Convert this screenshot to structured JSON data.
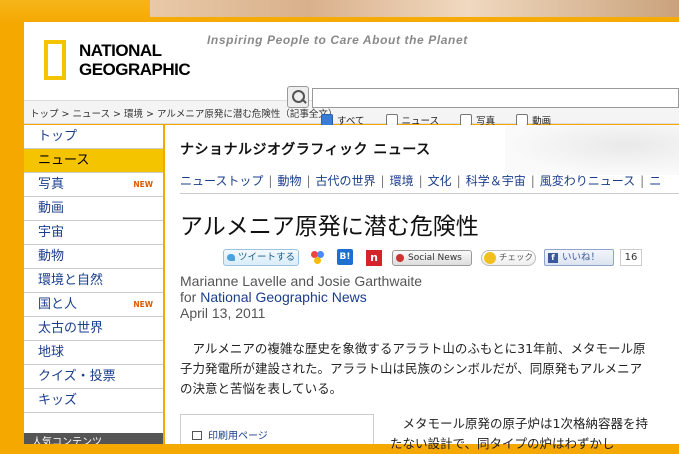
{
  "site": {
    "logo_line1": "NATIONAL",
    "logo_line2": "GEOGRAPHIC",
    "tagline": "Inspiring People to Care About the Planet",
    "brand_color": "#f5c400"
  },
  "breadcrumb": [
    "トップ",
    "ニュース",
    "環境",
    "アルメニア原発に潜む危険性（記事全文）"
  ],
  "breadcrumb_sep": ">",
  "search": {
    "placeholder": "",
    "filters": [
      {
        "label": "すべて",
        "checked": true
      },
      {
        "label": "ニュース",
        "checked": false
      },
      {
        "label": "写真",
        "checked": false
      },
      {
        "label": "動画",
        "checked": false
      }
    ]
  },
  "sidebar": {
    "items": [
      {
        "label": "トップ",
        "new": ""
      },
      {
        "label": "ニュース",
        "new": "",
        "active": true
      },
      {
        "label": "写真",
        "new": "NEW"
      },
      {
        "label": "動画",
        "new": ""
      },
      {
        "label": "宇宙",
        "new": ""
      },
      {
        "label": "動物",
        "new": ""
      },
      {
        "label": "環境と自然",
        "new": ""
      },
      {
        "label": "国と人",
        "new": "NEW"
      },
      {
        "label": "太古の世界",
        "new": ""
      },
      {
        "label": "地球",
        "new": ""
      },
      {
        "label": "クイズ・投票",
        "new": ""
      },
      {
        "label": "キッズ",
        "new": ""
      }
    ],
    "popular_heading": "人気コンテンツ"
  },
  "section": {
    "title": "ナショナルジオグラフィック ニュース",
    "subnav": [
      "ニューストップ",
      "動物",
      "古代の世界",
      "環境",
      "文化",
      "科学＆宇宙",
      "風変わりニュース",
      "ニ"
    ]
  },
  "article": {
    "title": "アルメニア原発に潜む危険性",
    "social": {
      "tweet": "ツイートする",
      "hatena": "B!",
      "n": "n",
      "social_news": "Social News",
      "check": "チェック",
      "like": "いいね！",
      "like_count": "16"
    },
    "author": "Marianne Lavelle and Josie Garthwaite",
    "for_prefix": "for ",
    "publication": "National Geographic News",
    "date": "April 13, 2011",
    "para1": "アルメニアの複雑な歴史を象徴するアララト山のふもとに31年前、メタモール原子力発電所が建設された。アララト山は民族のシンボルだが、同原発もアルメニアの決意と苦悩を表している。",
    "para2": "メタモール原発の原子炉は1次格納容器を持たない設計で、同タイプの炉はわずかし",
    "print_label": "印刷用ページ"
  }
}
